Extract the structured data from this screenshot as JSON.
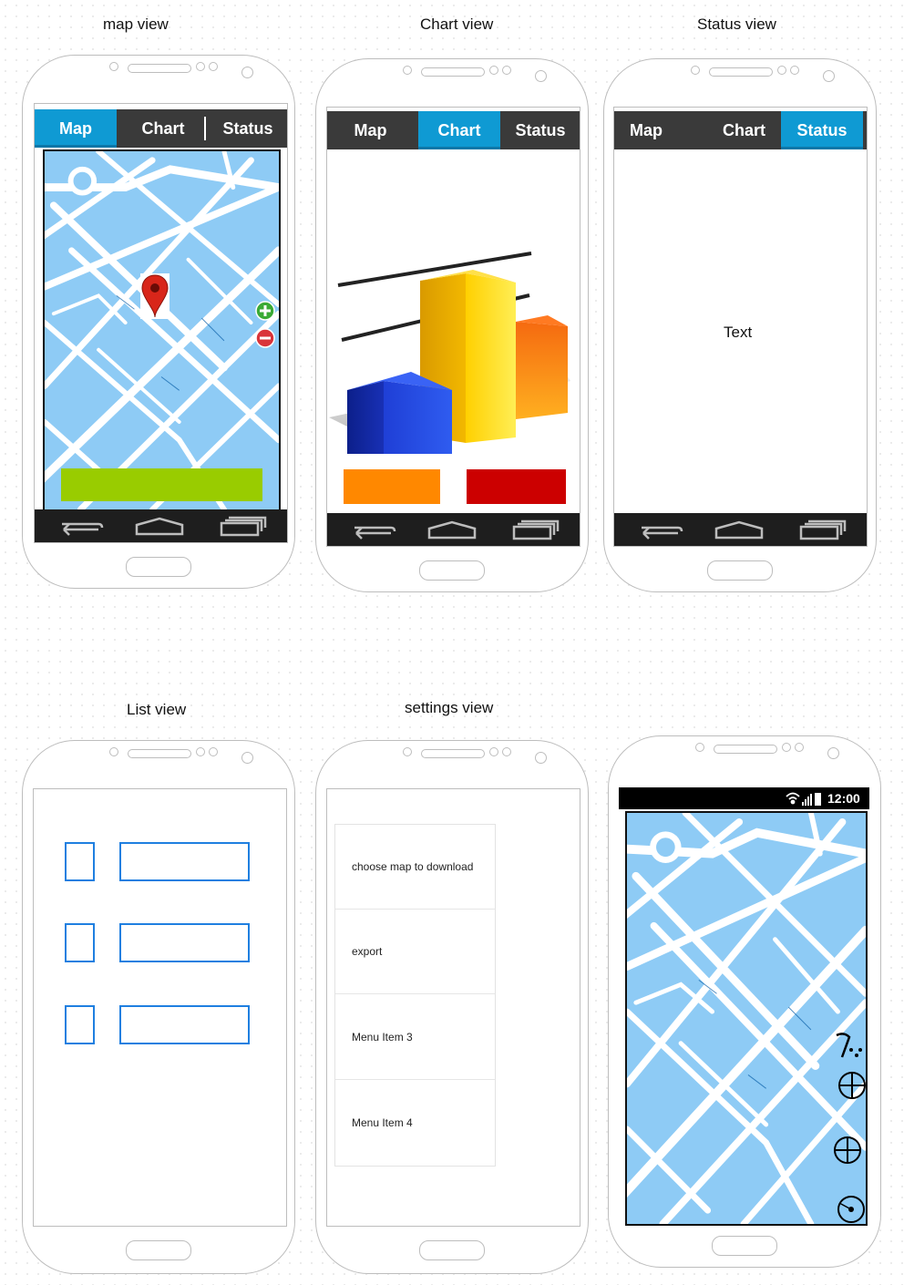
{
  "captions": {
    "map_view": "map view",
    "chart_view": "Chart view",
    "status_view": "Status view",
    "list_view": "List view",
    "settings_view": "settings view"
  },
  "tabs": {
    "map": "Map",
    "chart": "Chart",
    "status": "Status"
  },
  "status_view": {
    "text": "Text"
  },
  "settings_view": {
    "menu_items": [
      "choose map to download",
      "export",
      "Menu Item 3",
      "Menu Item 4"
    ]
  },
  "fullmap_view": {
    "clock": "12:00"
  },
  "colors": {
    "tab_active": "#0f9ad3",
    "tab_bar": "#3a3a3a",
    "map_water": "#8ecbf5",
    "green_button": "#99cc00",
    "orange_button": "#ff8800",
    "red_button": "#cc0000",
    "list_outline": "#1f7fe0"
  },
  "icons": [
    "back-icon",
    "home-icon",
    "recent-apps-icon",
    "map-pin-icon",
    "zoom-in-icon",
    "zoom-out-icon",
    "wifi-icon",
    "signal-icon",
    "battery-icon",
    "walking-icon",
    "crosshair-icon",
    "locate-icon"
  ]
}
